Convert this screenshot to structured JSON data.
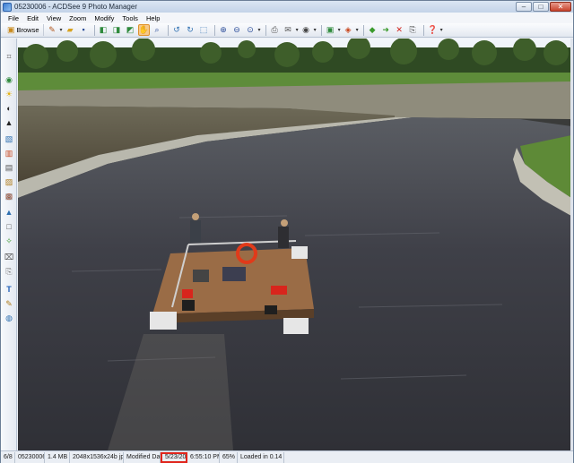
{
  "window": {
    "title": "05230006 - ACDSee 9 Photo Manager",
    "controls": {
      "minimize": "–",
      "maximize": "□",
      "close": "✕"
    }
  },
  "menu": [
    "File",
    "Edit",
    "View",
    "Zoom",
    "Modify",
    "Tools",
    "Help"
  ],
  "toolbar": {
    "browse_label": "Browse",
    "icons": [
      "browse-icon",
      "edit-icon",
      "open-folder-icon",
      "save-icon",
      "previous-image-icon",
      "next-image-icon",
      "first-image-icon",
      "active-tool-icon",
      "zoom-icon",
      "rotate-left-icon",
      "rotate-right-icon",
      "fit-image-icon",
      "zoom-in-icon",
      "zoom-out-icon",
      "zoom-dropdown-icon",
      "print-icon",
      "email-icon",
      "stamp-icon",
      "slideshow-icon",
      "color-icon",
      "share-icon",
      "forward-icon",
      "delete-icon",
      "properties-icon",
      "help-icon"
    ]
  },
  "left_tools": [
    "crop-icon",
    "red-eye-icon",
    "exposure-icon",
    "contrast-icon",
    "levels-icon",
    "color-balance-icon",
    "histogram-icon",
    "filter-icon",
    "brightness-icon",
    "sharpen-icon",
    "eye-icon",
    "triangle-icon",
    "frame-icon",
    "effects-icon",
    "crop-tool-icon",
    "clone-icon",
    "text-icon",
    "draw-icon",
    "globe-icon"
  ],
  "status": {
    "index": "6/8",
    "filename": "05230006",
    "filesize": "1.4 MB",
    "dimensions": "2048x1536x24b jpeg",
    "modified_label": "Modified Date:",
    "date": "5/23/2003",
    "time": "6:55:10 PM",
    "zoom": "65%",
    "load_time": "Loaded in 0.14 s"
  }
}
